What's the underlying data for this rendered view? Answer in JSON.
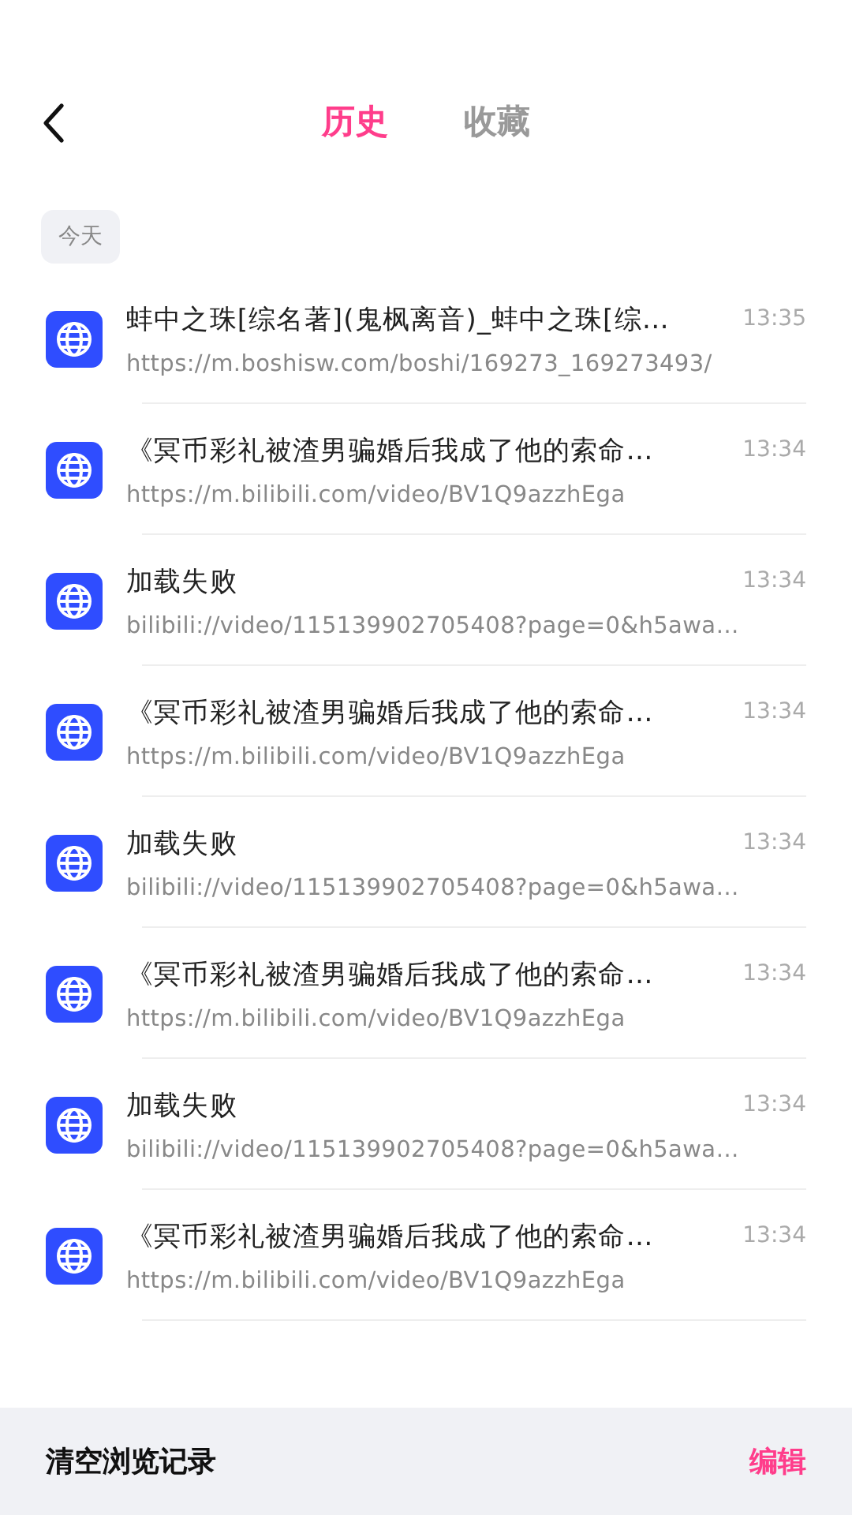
{
  "header": {
    "tabs": [
      {
        "label": "历史",
        "selected": true
      },
      {
        "label": "收藏",
        "selected": false
      }
    ]
  },
  "section": {
    "label": "今天"
  },
  "items": [
    {
      "title": "蚌中之珠[综名著](鬼枫离音)_蚌中之珠[综…",
      "url": "https://m.boshisw.com/boshi/169273_169273493/",
      "time": "13:35"
    },
    {
      "title": "《冥币彩礼被渣男骗婚后我成了他的索命…",
      "url": "https://m.bilibili.com/video/BV1Q9azzhEga",
      "time": "13:34"
    },
    {
      "title": "加载失败",
      "url": "bilibili://video/115139902705408?page=0&h5awa…",
      "time": "13:34"
    },
    {
      "title": "《冥币彩礼被渣男骗婚后我成了他的索命…",
      "url": "https://m.bilibili.com/video/BV1Q9azzhEga",
      "time": "13:34"
    },
    {
      "title": "加载失败",
      "url": "bilibili://video/115139902705408?page=0&h5awa…",
      "time": "13:34"
    },
    {
      "title": "《冥币彩礼被渣男骗婚后我成了他的索命…",
      "url": "https://m.bilibili.com/video/BV1Q9azzhEga",
      "time": "13:34"
    },
    {
      "title": "加载失败",
      "url": "bilibili://video/115139902705408?page=0&h5awa…",
      "time": "13:34"
    },
    {
      "title": "《冥币彩礼被渣男骗婚后我成了他的索命…",
      "url": "https://m.bilibili.com/video/BV1Q9azzhEga",
      "time": "13:34"
    }
  ],
  "footer": {
    "clear": "清空浏览记录",
    "edit": "编辑"
  }
}
